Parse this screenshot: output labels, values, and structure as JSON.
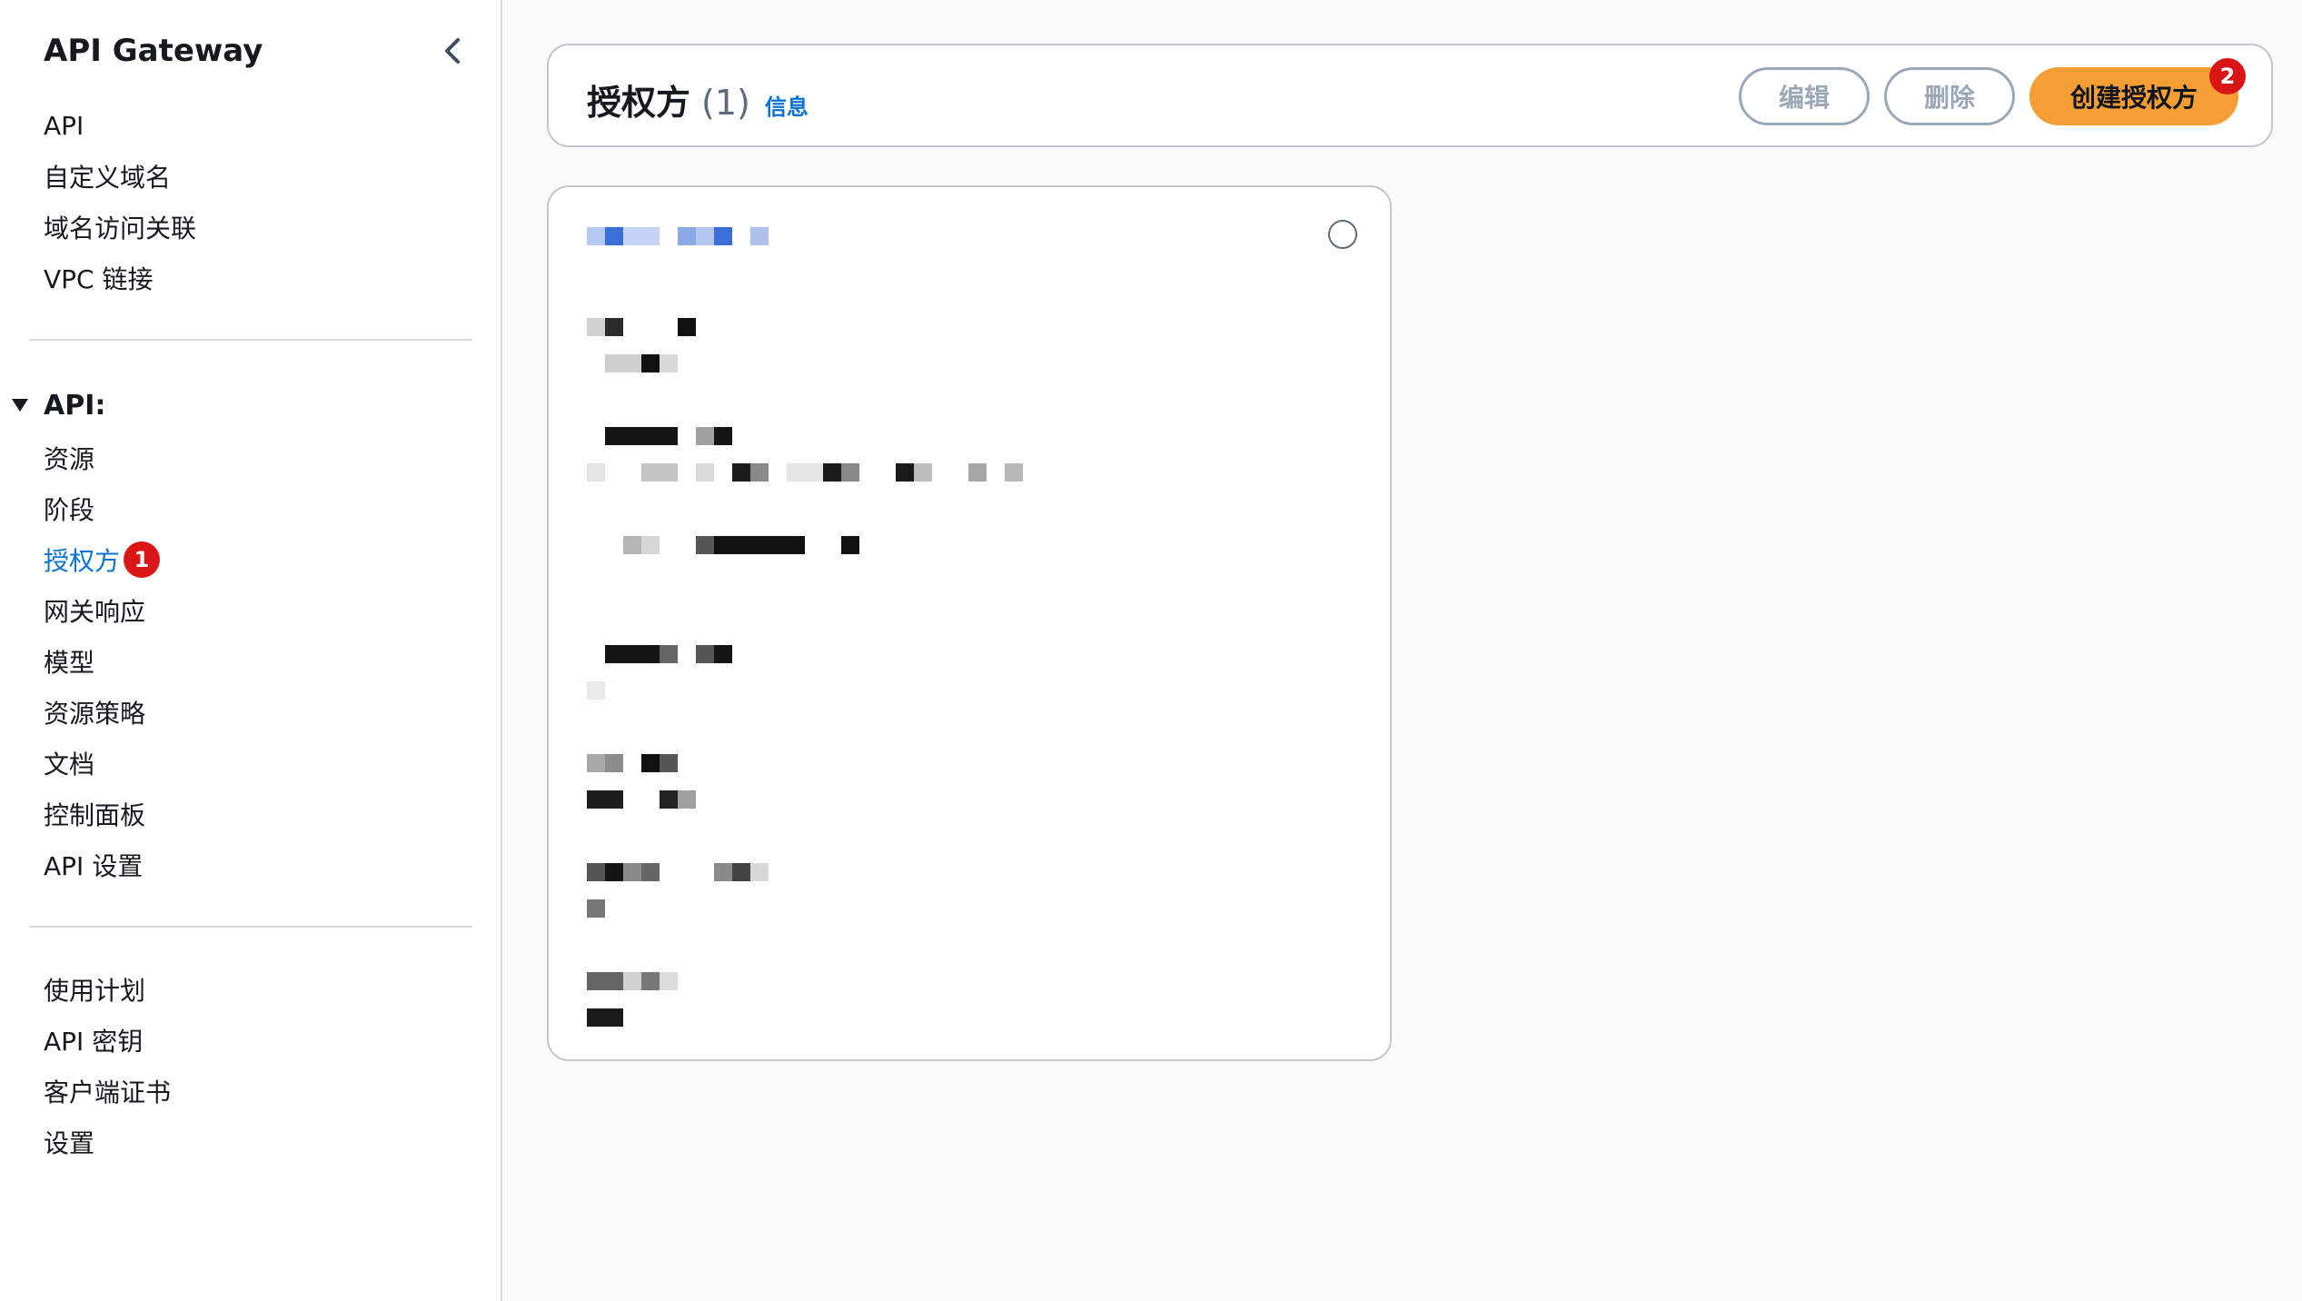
{
  "sidebar": {
    "title": "API Gateway",
    "top_items": [
      "API",
      "自定义域名",
      "域名访问关联",
      "VPC 链接"
    ],
    "section_label": "API:",
    "api_items": [
      {
        "label": "资源"
      },
      {
        "label": "阶段"
      },
      {
        "label": "授权方",
        "active": true,
        "badge": "1"
      },
      {
        "label": "网关响应"
      },
      {
        "label": "模型"
      },
      {
        "label": "资源策略"
      },
      {
        "label": "文档"
      },
      {
        "label": "控制面板"
      },
      {
        "label": "API 设置"
      }
    ],
    "bottom_items": [
      "使用计划",
      "API 密钥",
      "客户端证书",
      "设置"
    ]
  },
  "header": {
    "title": "授权方",
    "count": "(1)",
    "info_link": "信息",
    "edit_label": "编辑",
    "delete_label": "删除",
    "create_label": "创建授权方",
    "create_badge": "2"
  },
  "colors": {
    "accent": "#0972d3",
    "primary_button": "#f59e34",
    "badge": "#d91515"
  },
  "icons": {
    "collapse": "chevron-left-icon",
    "section": "caret-down-icon",
    "card_select": "radio-icon"
  }
}
